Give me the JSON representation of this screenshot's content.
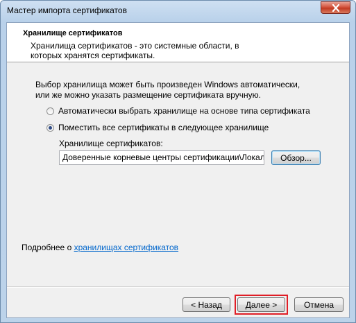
{
  "window": {
    "title": "Мастер импорта сертификатов"
  },
  "header": {
    "title": "Хранилище сертификатов",
    "description": "Хранилища сертификатов - это системные области, в которых хранятся сертификаты."
  },
  "intro": "Выбор хранилища может быть произведен Windows автоматически, или же можно указать размещение сертификата вручную.",
  "options": {
    "auto": {
      "label": "Автоматически выбрать хранилище на основе типа сертификата",
      "checked": false
    },
    "manual": {
      "label": "Поместить все сертификаты в следующее хранилище",
      "checked": true
    }
  },
  "store": {
    "label": "Хранилище сертификатов:",
    "value": "Доверенные корневые центры сертификации\\Локальный компьютер",
    "browse_label": "Обзор..."
  },
  "more": {
    "prefix": "Подробнее о ",
    "link": "хранилищах сертификатов"
  },
  "footer": {
    "back_label": "< Назад",
    "next_label": "Далее >",
    "cancel_label": "Отмена"
  },
  "colors": {
    "highlight": "#e01e26",
    "link": "#0066cc",
    "close_button": "#c23a22"
  },
  "icons": {
    "close": "close-icon"
  }
}
